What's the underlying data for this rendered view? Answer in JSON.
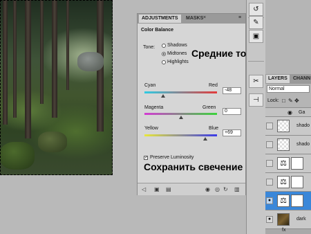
{
  "adjustments": {
    "tabs": [
      "ADJUSTMENTS",
      "MASKS"
    ],
    "title": "Color Balance",
    "tone_label": "Tone:",
    "tones": [
      {
        "label": "Shadows",
        "selected": false
      },
      {
        "label": "Midtones",
        "selected": true
      },
      {
        "label": "Highlights",
        "selected": false
      }
    ],
    "tone_annotation": "Средние тона",
    "sliders": [
      {
        "left": "Cyan",
        "right": "Red",
        "value": "-48",
        "fraction": 0.26,
        "from": "#2ecbe3",
        "to": "#e33a3a"
      },
      {
        "left": "Magenta",
        "right": "Green",
        "value": "0",
        "fraction": 0.5,
        "from": "#d43ad4",
        "to": "#3ad43a"
      },
      {
        "left": "Yellow",
        "right": "Blue",
        "value": "+69",
        "fraction": 0.84,
        "from": "#e8e83a",
        "to": "#3a3ae8"
      }
    ],
    "preserve_label": "Preserve Luminosity",
    "preserve_checked": true,
    "preserve_annotation": "Сохранить свечение"
  },
  "layers": {
    "tabs": [
      "LAYERS",
      "CHANN"
    ],
    "blend_mode": "Normal",
    "lock_label": "Lock:",
    "group_name": "Ga",
    "rows": [
      {
        "name": "shado",
        "kind": "transparent"
      },
      {
        "name": "shado",
        "kind": "transparent"
      },
      {
        "name": "",
        "kind": "adjustment"
      },
      {
        "name": "",
        "kind": "adjustment"
      },
      {
        "name": "",
        "kind": "adjustment-selected"
      },
      {
        "name": "dark",
        "kind": "image"
      }
    ]
  }
}
